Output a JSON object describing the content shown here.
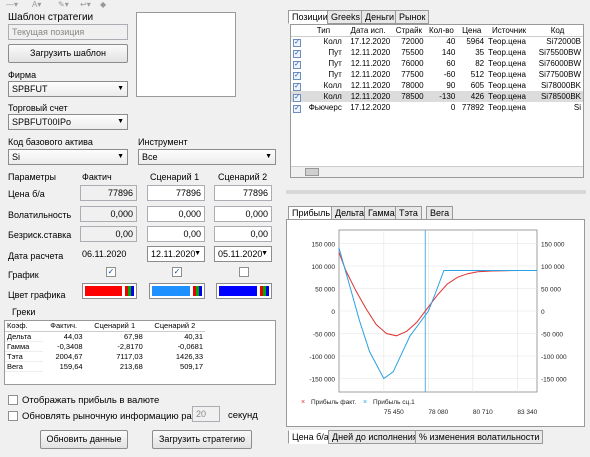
{
  "toolbar": {
    "icons": [
      "line-tool-icon",
      "text-tool-icon",
      "pen-tool-icon",
      "arrow-tool-icon",
      "shape-tool-icon"
    ]
  },
  "template": {
    "label": "Шаблон стратегии",
    "current_placeholder": "Текущая позиция",
    "load_button": "Загрузить шаблон"
  },
  "firm": {
    "label": "Фирма",
    "value": "SPBFUT"
  },
  "account": {
    "label": "Торговый счет",
    "value": "SPBFUT00IPo"
  },
  "base_code": {
    "label": "Код базового актива",
    "value": "Si"
  },
  "instrument": {
    "label": "Инструмент",
    "value": "Все"
  },
  "params": {
    "header": {
      "param": "Параметры",
      "fact": "Фактич",
      "sc1": "Сценарий 1",
      "sc2": "Сценарий 2"
    },
    "rows": [
      {
        "label": "Цена б/а",
        "fact": "77896",
        "sc1": "77896",
        "sc2": "77896"
      },
      {
        "label": "Волатильность",
        "fact": "0,000",
        "sc1": "0,000",
        "sc2": "0,000"
      },
      {
        "label": "Безриск.ставка",
        "fact": "0,00",
        "sc1": "0,00",
        "sc2": "0,00"
      },
      {
        "label": "Дата расчета",
        "fact": "06.11.2020",
        "sc1": "12.11.2020",
        "sc2": "05.11.2020"
      }
    ],
    "chart_label": "График",
    "chart_checks": {
      "fact": true,
      "sc1": true,
      "sc2": false
    },
    "color_label": "Цвет графика",
    "colors": {
      "fact": "#ff0000",
      "sc1": "#1e90ff",
      "sc2": "#0000ff"
    }
  },
  "greeks": {
    "title": "Греки",
    "headers": [
      "Коэф.",
      "Фактич.",
      "Сценарий 1",
      "Сценарий 2"
    ],
    "rows": [
      [
        "Дельта",
        "44,03",
        "67,98",
        "40,31"
      ],
      [
        "Гамма",
        "-0,3408",
        "-2,8170",
        "-0,0681"
      ],
      [
        "Тэта",
        "2004,67",
        "7117,03",
        "1426,33"
      ],
      [
        "Вега",
        "159,64",
        "213,68",
        "509,17"
      ]
    ]
  },
  "options": {
    "show_currency": "Отображать прибыль в валюте",
    "refresh_label": "Обновлять рыночную информацию раз в",
    "refresh_value": "20",
    "refresh_unit": "секунд"
  },
  "buttons": {
    "update": "Обновить данные",
    "load_strategy": "Загрузить стратегию"
  },
  "top_tabs": [
    "Позиции",
    "Greeks",
    "Деньги",
    "Рынок"
  ],
  "positions": {
    "headers": [
      "",
      "Тип",
      "Дата исп.",
      "Страйк",
      "Кол-во",
      "Цена",
      "Источник",
      "Код"
    ],
    "rows": [
      {
        "checked": true,
        "type": "Колл",
        "date": "17.12.2020",
        "strike": "72000",
        "qty": "40",
        "price": "5964",
        "source": "Теор.цена",
        "code": "Si72000B"
      },
      {
        "checked": true,
        "type": "Пут",
        "date": "12.11.2020",
        "strike": "75500",
        "qty": "140",
        "price": "35",
        "source": "Теор.цена",
        "code": "Si75500BW"
      },
      {
        "checked": true,
        "type": "Пут",
        "date": "12.11.2020",
        "strike": "76000",
        "qty": "60",
        "price": "82",
        "source": "Теор.цена",
        "code": "Si76000BW"
      },
      {
        "checked": true,
        "type": "Пут",
        "date": "12.11.2020",
        "strike": "77500",
        "qty": "-60",
        "price": "512",
        "source": "Теор.цена",
        "code": "Si77500BW"
      },
      {
        "checked": true,
        "type": "Колл",
        "date": "12.11.2020",
        "strike": "78000",
        "qty": "90",
        "price": "605",
        "source": "Теор.цена",
        "code": "Si78000BK"
      },
      {
        "checked": true,
        "type": "Колл",
        "date": "12.11.2020",
        "strike": "78500",
        "qty": "-130",
        "price": "426",
        "source": "Теор.цена",
        "code": "Si78500BK"
      },
      {
        "checked": true,
        "type": "Фьючерс",
        "date": "17.12.2020",
        "strike": "",
        "qty": "0",
        "price": "77892",
        "source": "Теор.цена",
        "code": "Si"
      }
    ]
  },
  "chart_tabs": [
    "Прибыль",
    "Дельта",
    "Гамма",
    "Тэта",
    "Вега"
  ],
  "bottom_tabs": [
    "Цена б/а",
    "Дней до исполнения",
    "% изменения волатильности"
  ],
  "chart_data": {
    "type": "line",
    "x_ticks": [
      "75 450",
      "78 080",
      "80 710",
      "83 340"
    ],
    "x_tick_values": [
      75450,
      78080,
      80710,
      83340
    ],
    "xlim": [
      72800,
      84500
    ],
    "y_left_ticks": [
      "150 000",
      "100 000",
      "50 000",
      "0",
      "-50 000",
      "-100 000",
      "-150 000"
    ],
    "y_right_ticks": [
      "150 000",
      "100 000",
      "50 000",
      "0",
      "-50 000",
      "-100 000",
      "-150 000"
    ],
    "ylim": [
      -180000,
      180000
    ],
    "vline_x": 77896,
    "series": [
      {
        "name": "Прибыль факт.",
        "color": "#e03030",
        "x": [
          72800,
          73200,
          73800,
          74400,
          75000,
          75600,
          76200,
          76800,
          77400,
          78000,
          78600,
          79200,
          79800,
          80400,
          81000,
          81800,
          82600,
          83400,
          84500
        ],
        "y": [
          130000,
          90000,
          45000,
          5000,
          -30000,
          -50000,
          -55000,
          -45000,
          -25000,
          5000,
          35000,
          60000,
          75000,
          83000,
          87000,
          89000,
          89500,
          90000,
          90000
        ]
      },
      {
        "name": "Прибыль сц.1",
        "color": "#2aa0e0",
        "x": [
          72800,
          73400,
          74000,
          74600,
          75450,
          76000,
          76500,
          77000,
          77500,
          78080,
          78500,
          79000,
          80000,
          81500,
          83340,
          84500
        ],
        "y": [
          140000,
          60000,
          -20000,
          -90000,
          -150000,
          -135000,
          -95000,
          -55000,
          -30000,
          0,
          40000,
          90000,
          90000,
          90000,
          90000,
          90000
        ]
      }
    ]
  }
}
